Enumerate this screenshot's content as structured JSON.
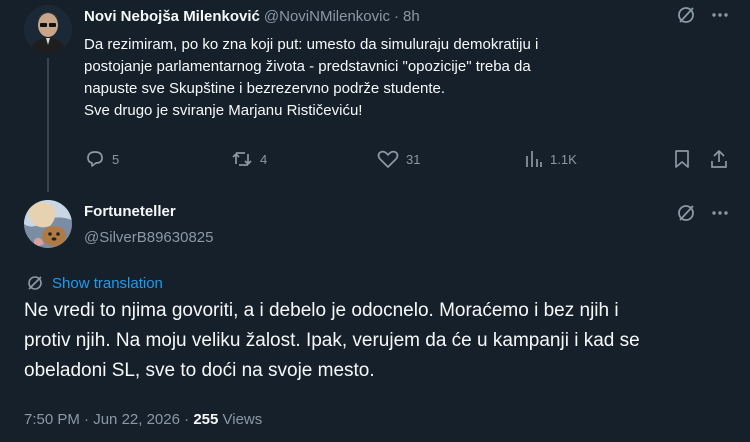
{
  "tweet1": {
    "author_name": "Novi Nebojša Milenković",
    "handle": "@NoviNMilenkovic",
    "separator": "·",
    "time": "8h",
    "lines": [
      "Da rezimiram, po ko zna koji put: umesto da simuluraju demokratiju i",
      "postojanje parlamentarnog života - predstavnici \"opozicije\" treba da",
      "napuste sve Skupštine i bezrezervno podrže studente.",
      "Sve drugo je sviranje Marjanu Rističeviću!"
    ],
    "actions": {
      "replies": "5",
      "reposts": "4",
      "likes": "31",
      "views": "1.1K"
    }
  },
  "tweet2": {
    "author_name": "Fortuneteller",
    "handle": "@SilverB89630825",
    "show_translation": "Show translation",
    "lines": [
      "Ne vredi to njima govoriti, a i debelo je odocnelo. Moraćemo i bez njih i",
      "protiv njih. Na moju veliku žalost. Ipak, verujem da će u kampanji i kad se",
      "obeladoni SL, sve to doći na svoje mesto."
    ],
    "meta": {
      "time": "7:50 PM",
      "dot1": "·",
      "date": "Jun 22, 2026",
      "dot2": "·",
      "views_count": "255",
      "views_label": "Views"
    }
  },
  "colors": {
    "background": "#15202b",
    "text": "#f7f9f9",
    "muted": "#8b98a5",
    "accent": "#1d9bf0",
    "divider": "#38444d"
  },
  "icons": {
    "grok": "grok-icon",
    "more": "more-icon",
    "reply": "reply-icon",
    "repost": "repost-icon",
    "like": "like-icon",
    "views": "views-icon",
    "bookmark": "bookmark-icon",
    "share": "share-icon",
    "translate": "translate-icon"
  }
}
